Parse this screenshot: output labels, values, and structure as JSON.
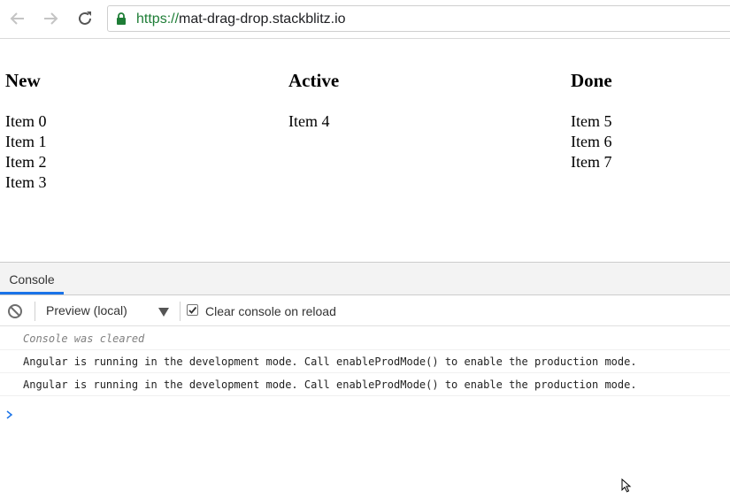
{
  "browser": {
    "url_scheme": "https://",
    "url_host": "mat-drag-drop.stackblitz.io",
    "icons": [
      "back-arrow-icon",
      "forward-arrow-icon",
      "reload-icon",
      "lock-icon"
    ]
  },
  "board": {
    "columns": [
      {
        "title": "New",
        "items": [
          "Item 0",
          "Item 1",
          "Item 2",
          "Item 3"
        ]
      },
      {
        "title": "Active",
        "items": [
          "Item 4"
        ]
      },
      {
        "title": "Done",
        "items": [
          "Item 5",
          "Item 6",
          "Item 7"
        ]
      }
    ]
  },
  "devtools": {
    "tab_label": "Console",
    "context_label": "Preview (local)",
    "clear_on_reload_label": "Clear console on reload",
    "clear_on_reload_checked": true,
    "messages": [
      "Console was cleared",
      "Angular is running in the development mode. Call enableProdMode() to enable the production mode.",
      "Angular is running in the development mode. Call enableProdMode() to enable the production mode."
    ],
    "accent_color": "#1a73e8"
  }
}
